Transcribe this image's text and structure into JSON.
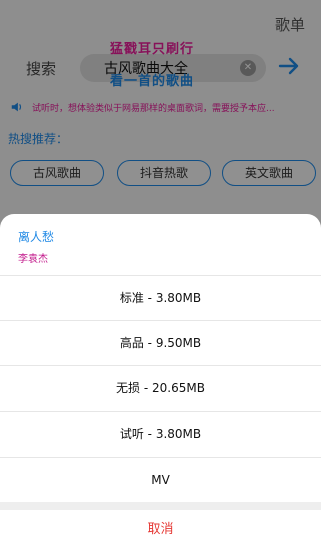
{
  "header": {
    "playlist_label": "歌单"
  },
  "search": {
    "label": "搜索",
    "query": "古风歌曲大全",
    "clear_icon": "clear-icon",
    "submit_icon": "arrow-right-icon"
  },
  "overlay": {
    "line1": "猛戳耳只刷行",
    "line2": "看一首的歌曲"
  },
  "notice": {
    "icon": "speaker-icon",
    "text": "试听时，想体验类似于网易那样的桌面歌词，需要授予本应..."
  },
  "recommend": {
    "title": "热搜推荐：",
    "chips": [
      "古风歌曲",
      "抖音热歌",
      "英文歌曲"
    ]
  },
  "sheet": {
    "song_title": "离人愁",
    "artist": "李袁杰",
    "options": [
      "标准 - 3.80MB",
      "高品 - 9.50MB",
      "无损 - 20.65MB",
      "试听 - 3.80MB",
      "MV"
    ],
    "cancel_label": "取消"
  },
  "colors": {
    "accent": "#1e88e5",
    "pink": "#e91e9a",
    "cancel": "#e53935"
  }
}
